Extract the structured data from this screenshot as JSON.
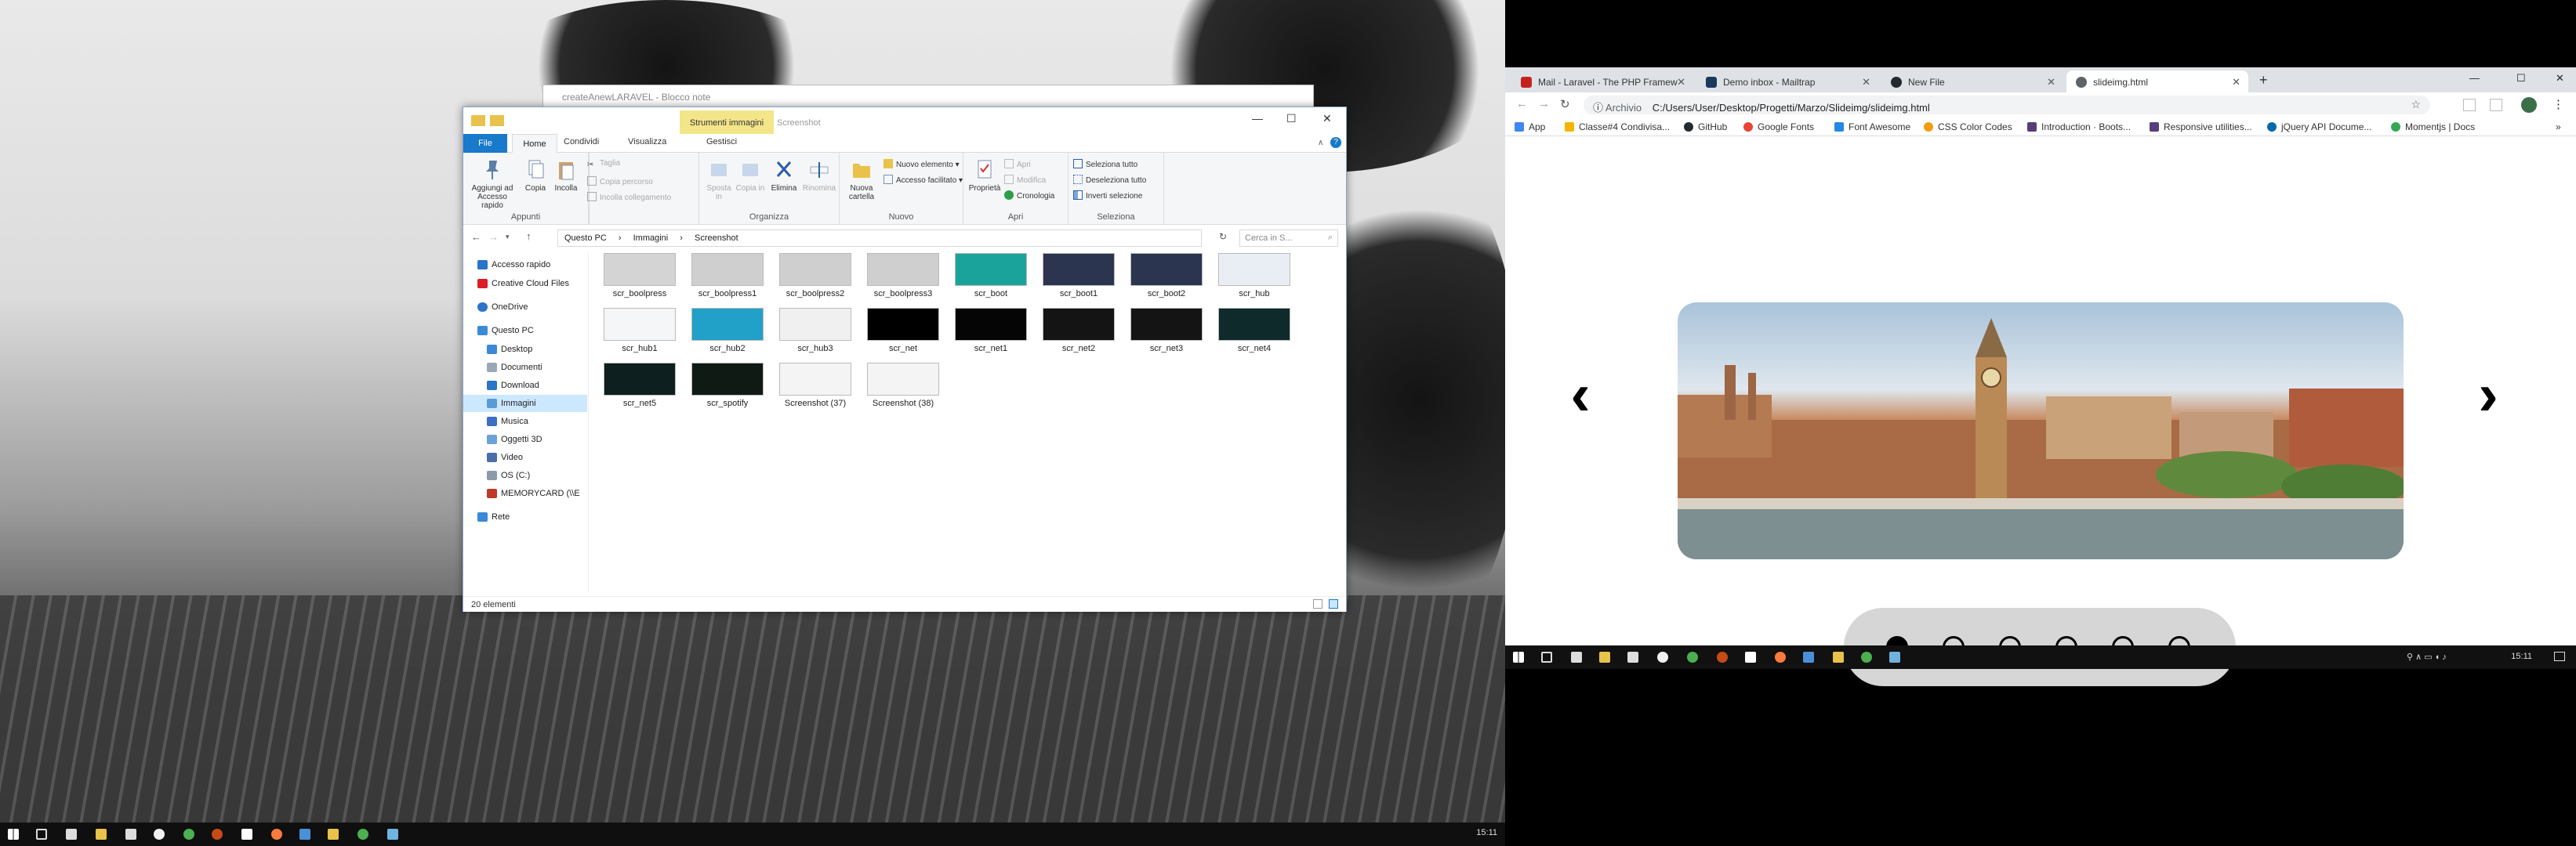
{
  "left_monitor": {
    "notepad_title": "createAnewLARAVEL - Blocco note",
    "explorer": {
      "context_tab": "Strumenti immagini",
      "context_subtitle": "Screenshot",
      "tabs": [
        "File",
        "Home",
        "Condividi",
        "Visualizza",
        "Gestisci"
      ],
      "ribbon": {
        "appunti": {
          "label": "Appunti",
          "pin": "Aggiungi ad Accesso rapido",
          "copy": "Copia",
          "paste": "Incolla",
          "cut": "Taglia",
          "copy_path": "Copia percorso",
          "paste_link": "Incolla collegamento"
        },
        "organizza": {
          "label": "Organizza",
          "move": "Sposta in",
          "copy_to": "Copia in",
          "delete": "Elimina",
          "rename": "Rinomina"
        },
        "nuovo": {
          "label": "Nuovo",
          "new_folder": "Nuova cartella",
          "new_item": "Nuovo elemento",
          "easy_access": "Accesso facilitato"
        },
        "apri": {
          "label": "Apri",
          "properties": "Proprietà",
          "open": "Apri",
          "edit": "Modifica",
          "history": "Cronologia"
        },
        "seleziona": {
          "label": "Seleziona",
          "select_all": "Seleziona tutto",
          "select_none": "Deseleziona tutto",
          "invert": "Inverti selezione"
        }
      },
      "breadcrumb": [
        "Questo PC",
        "Immagini",
        "Screenshot"
      ],
      "search_placeholder": "Cerca in S...",
      "nav": [
        "Accesso rapido",
        "Creative Cloud Files",
        "OneDrive",
        "Questo PC",
        "Desktop",
        "Documenti",
        "Download",
        "Immagini",
        "Musica",
        "Oggetti 3D",
        "Video",
        "OS (C:)",
        "MEMORYCARD (\\\\E",
        "Rete"
      ],
      "nav_selected": "Immagini",
      "files": [
        "scr_boolpress",
        "scr_boolpress1",
        "scr_boolpress2",
        "scr_boolpress3",
        "scr_boot",
        "scr_boot1",
        "scr_boot2",
        "scr_hub",
        "scr_hub1",
        "scr_hub2",
        "scr_hub3",
        "scr_net",
        "scr_net1",
        "scr_net2",
        "scr_net3",
        "scr_net4",
        "scr_net5",
        "scr_spotify",
        "Screenshot (37)",
        "Screenshot (38)"
      ],
      "status": "20 elementi"
    },
    "taskbar_clock": "15:11"
  },
  "right_monitor": {
    "browser": {
      "tabs": [
        {
          "title": "Mail - Laravel - The PHP Framew",
          "color": "#c5221f"
        },
        {
          "title": "Demo inbox - Mailtrap",
          "color": "#1a3a5c"
        },
        {
          "title": "New File",
          "color": "#24292e"
        },
        {
          "title": "slideimg.html",
          "color": "#5f6368"
        }
      ],
      "archive_label": "Archivio",
      "url": "C:/Users/User/Desktop/Progetti/Marzo/Slideimg/slideimg.html",
      "bookmarks": [
        "App",
        "Classe#4 Condivisa...",
        "GitHub",
        "Google Fonts",
        "Font Awesome",
        "CSS Color Codes",
        "Introduction · Boots...",
        "Responsive utilities...",
        "jQuery API Docume...",
        "Momentjs | Docs"
      ]
    },
    "slider": {
      "prev": "‹",
      "next": "›",
      "dot_count": 6,
      "active_dot": 0
    },
    "taskbar_clock": "15:11"
  }
}
